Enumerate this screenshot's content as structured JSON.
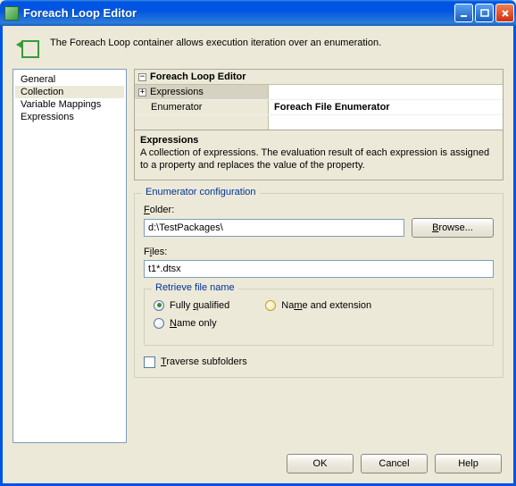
{
  "window": {
    "title": "Foreach Loop Editor"
  },
  "header": {
    "description": "The Foreach Loop container allows execution iteration over an enumeration."
  },
  "sidebar": {
    "items": [
      {
        "label": "General"
      },
      {
        "label": "Collection"
      },
      {
        "label": "Variable Mappings"
      },
      {
        "label": "Expressions"
      }
    ],
    "selected": 1
  },
  "propgrid": {
    "title": "Foreach Loop Editor",
    "rows": [
      {
        "name": "Expressions",
        "value": ""
      },
      {
        "name": "Enumerator",
        "value": "Foreach File Enumerator"
      }
    ]
  },
  "description": {
    "title": "Expressions",
    "text": "A collection of expressions. The evaluation result of each expression is assigned to a property and replaces the value of the property."
  },
  "config": {
    "legend": "Enumerator configuration",
    "folder_label": "Folder:",
    "folder_value": "d:\\TestPackages\\",
    "browse_label": "Browse...",
    "files_label": "Files:",
    "files_value": "t1*.dtsx",
    "retrieve": {
      "legend": "Retrieve file name",
      "fully_qualified": "Fully qualified",
      "name_extension": "Name and extension",
      "name_only": "Name only"
    },
    "traverse_label": "Traverse subfolders"
  },
  "footer": {
    "ok": "OK",
    "cancel": "Cancel",
    "help": "Help"
  }
}
